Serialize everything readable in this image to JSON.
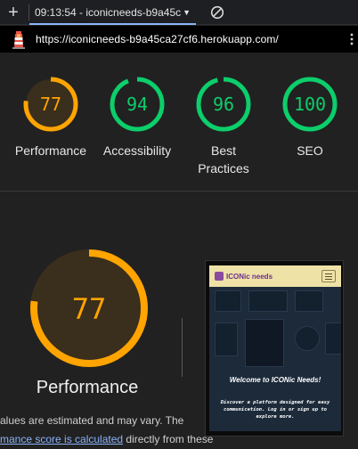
{
  "toolbar": {
    "add_icon": "plus-icon",
    "report_label": "09:13:54 - iconicneeds-b9a45c",
    "caret_icon": "caret-down-icon",
    "clear_icon": "block-icon"
  },
  "url_bar": {
    "logo_icon": "lighthouse-icon",
    "url": "https://iconicneeds-b9a45ca27cf6.herokuapp.com/",
    "menu_icon": "more-vertical-icon"
  },
  "colors": {
    "average": "#ffa400",
    "pass": "#0cce6b",
    "average_bg": "#3a2e1c",
    "pass_bg": "#183a26",
    "link": "#8ab4f8"
  },
  "scores": [
    {
      "label": "Performance",
      "value": "77",
      "score": 0.77,
      "status": "average"
    },
    {
      "label": "Accessibility",
      "value": "94",
      "score": 0.94,
      "status": "pass"
    },
    {
      "label": "Best Practices",
      "value": "96",
      "score": 0.96,
      "status": "pass"
    },
    {
      "label": "SEO",
      "value": "100",
      "score": 1.0,
      "status": "pass"
    }
  ],
  "performance": {
    "value": "77",
    "score": 0.77,
    "title": "Performance",
    "desc_line1": "alues are estimated and may vary. The",
    "desc_link": "mance score is calculated",
    "desc_rest": " directly from these"
  },
  "screenshot": {
    "brand": "ICONic needs",
    "welcome": "Welcome to ICONic Needs!",
    "subtitle": "Discover a platform designed for easy communication. Log in or sign up to explore more."
  }
}
